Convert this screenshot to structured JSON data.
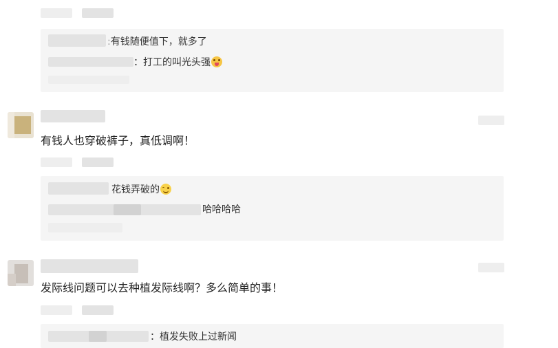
{
  "comments": [
    {
      "replies": [
        {
          "text": "有钱随便值下，就多了",
          "prefix": ":"
        },
        {
          "text": "打工的叫光头强",
          "prefix": "：",
          "emoji": "tongue-out-emoji"
        }
      ]
    },
    {
      "text": "有钱人也穿破裤子，真低调啊！",
      "replies": [
        {
          "text": "花钱弄破的",
          "emoji": "smile-emoji"
        },
        {
          "text": "哈哈哈哈"
        }
      ]
    },
    {
      "text": "发际线问题可以去种植发际线啊？多么简单的事！",
      "replies": [
        {
          "text": "植发失败上过新闻",
          "prefix": "："
        }
      ]
    }
  ]
}
